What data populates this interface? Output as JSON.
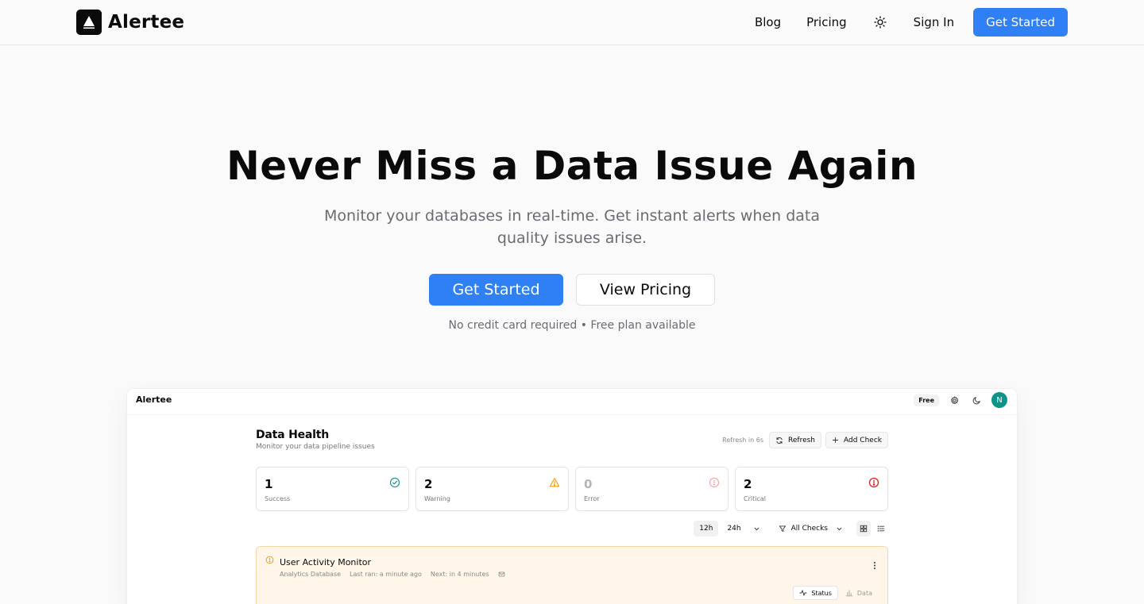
{
  "nav": {
    "brand": "Alertee",
    "links": [
      "Blog",
      "Pricing"
    ],
    "sign_in": "Sign In",
    "cta": "Get Started",
    "theme_icon": "sun-icon"
  },
  "hero": {
    "title": "Never Miss a Data Issue Again",
    "subtitle": "Monitor your databases in real-time. Get instant alerts when data quality issues arise.",
    "primary_cta": "Get Started",
    "secondary_cta": "View Pricing",
    "note": "No credit card required • Free plan available"
  },
  "preview": {
    "brand": "Alertee",
    "plan_badge": "Free",
    "avatar_initial": "N",
    "title": "Data Health",
    "subtitle": "Monitor your data pipeline issues",
    "refresh_note": "Refresh in 6s",
    "refresh_label": "Refresh",
    "add_check_label": "Add Check",
    "stats": [
      {
        "count": "1",
        "label": "Success",
        "color": "#0d9488"
      },
      {
        "count": "2",
        "label": "Warning",
        "color": "#f59e0b"
      },
      {
        "count": "0",
        "label": "Error",
        "color": "#f4a3a3"
      },
      {
        "count": "2",
        "label": "Critical",
        "color": "#dc2626"
      }
    ],
    "filters": {
      "range_12h": "12h",
      "range_24h": "24h",
      "all_checks": "All Checks"
    },
    "monitor": {
      "title": "User Activity Monitor",
      "database": "Analytics Database",
      "last_ran": "Last ran: a minute ago",
      "next": "Next: in 4 minutes",
      "tab_status": "Status",
      "tab_data": "Data",
      "accent": "#f59e0b"
    }
  }
}
